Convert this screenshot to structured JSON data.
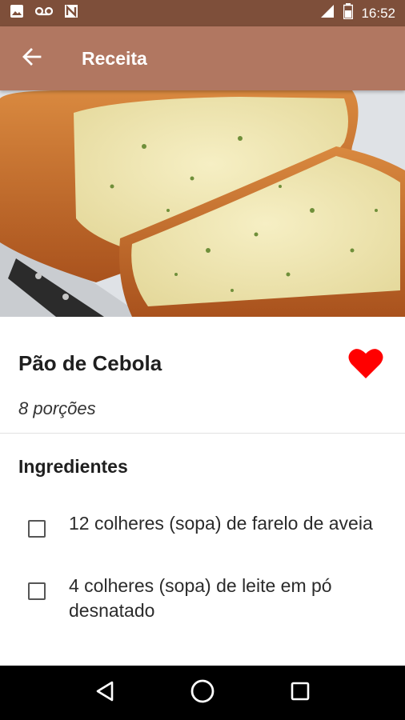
{
  "status_bar": {
    "time": "16:52",
    "icons": [
      "image-icon",
      "voicemail-icon",
      "n-notification-icon",
      "signal-icon",
      "battery-icon"
    ]
  },
  "app_bar": {
    "title": "Receita",
    "back_icon": "arrow-left-icon"
  },
  "hero": {
    "image_description": "onion-bread-loaf"
  },
  "recipe": {
    "title": "Pão de Cebola",
    "portions": "8 porções",
    "favorite_icon": "heart-icon",
    "favorite_color": "#ff0000"
  },
  "ingredients_section": {
    "title": "Ingredientes",
    "items": [
      {
        "text": "12 colheres (sopa) de farelo de aveia",
        "checked": false
      },
      {
        "text": "4 colheres (sopa) de leite em pó desnatado",
        "checked": false
      }
    ]
  },
  "nav_bar": {
    "buttons": [
      "back-triangle-icon",
      "home-circle-icon",
      "recents-square-icon"
    ]
  },
  "colors": {
    "status_bar": "#7e4f3a",
    "app_bar": "#b17761",
    "heart": "#ff0000"
  }
}
